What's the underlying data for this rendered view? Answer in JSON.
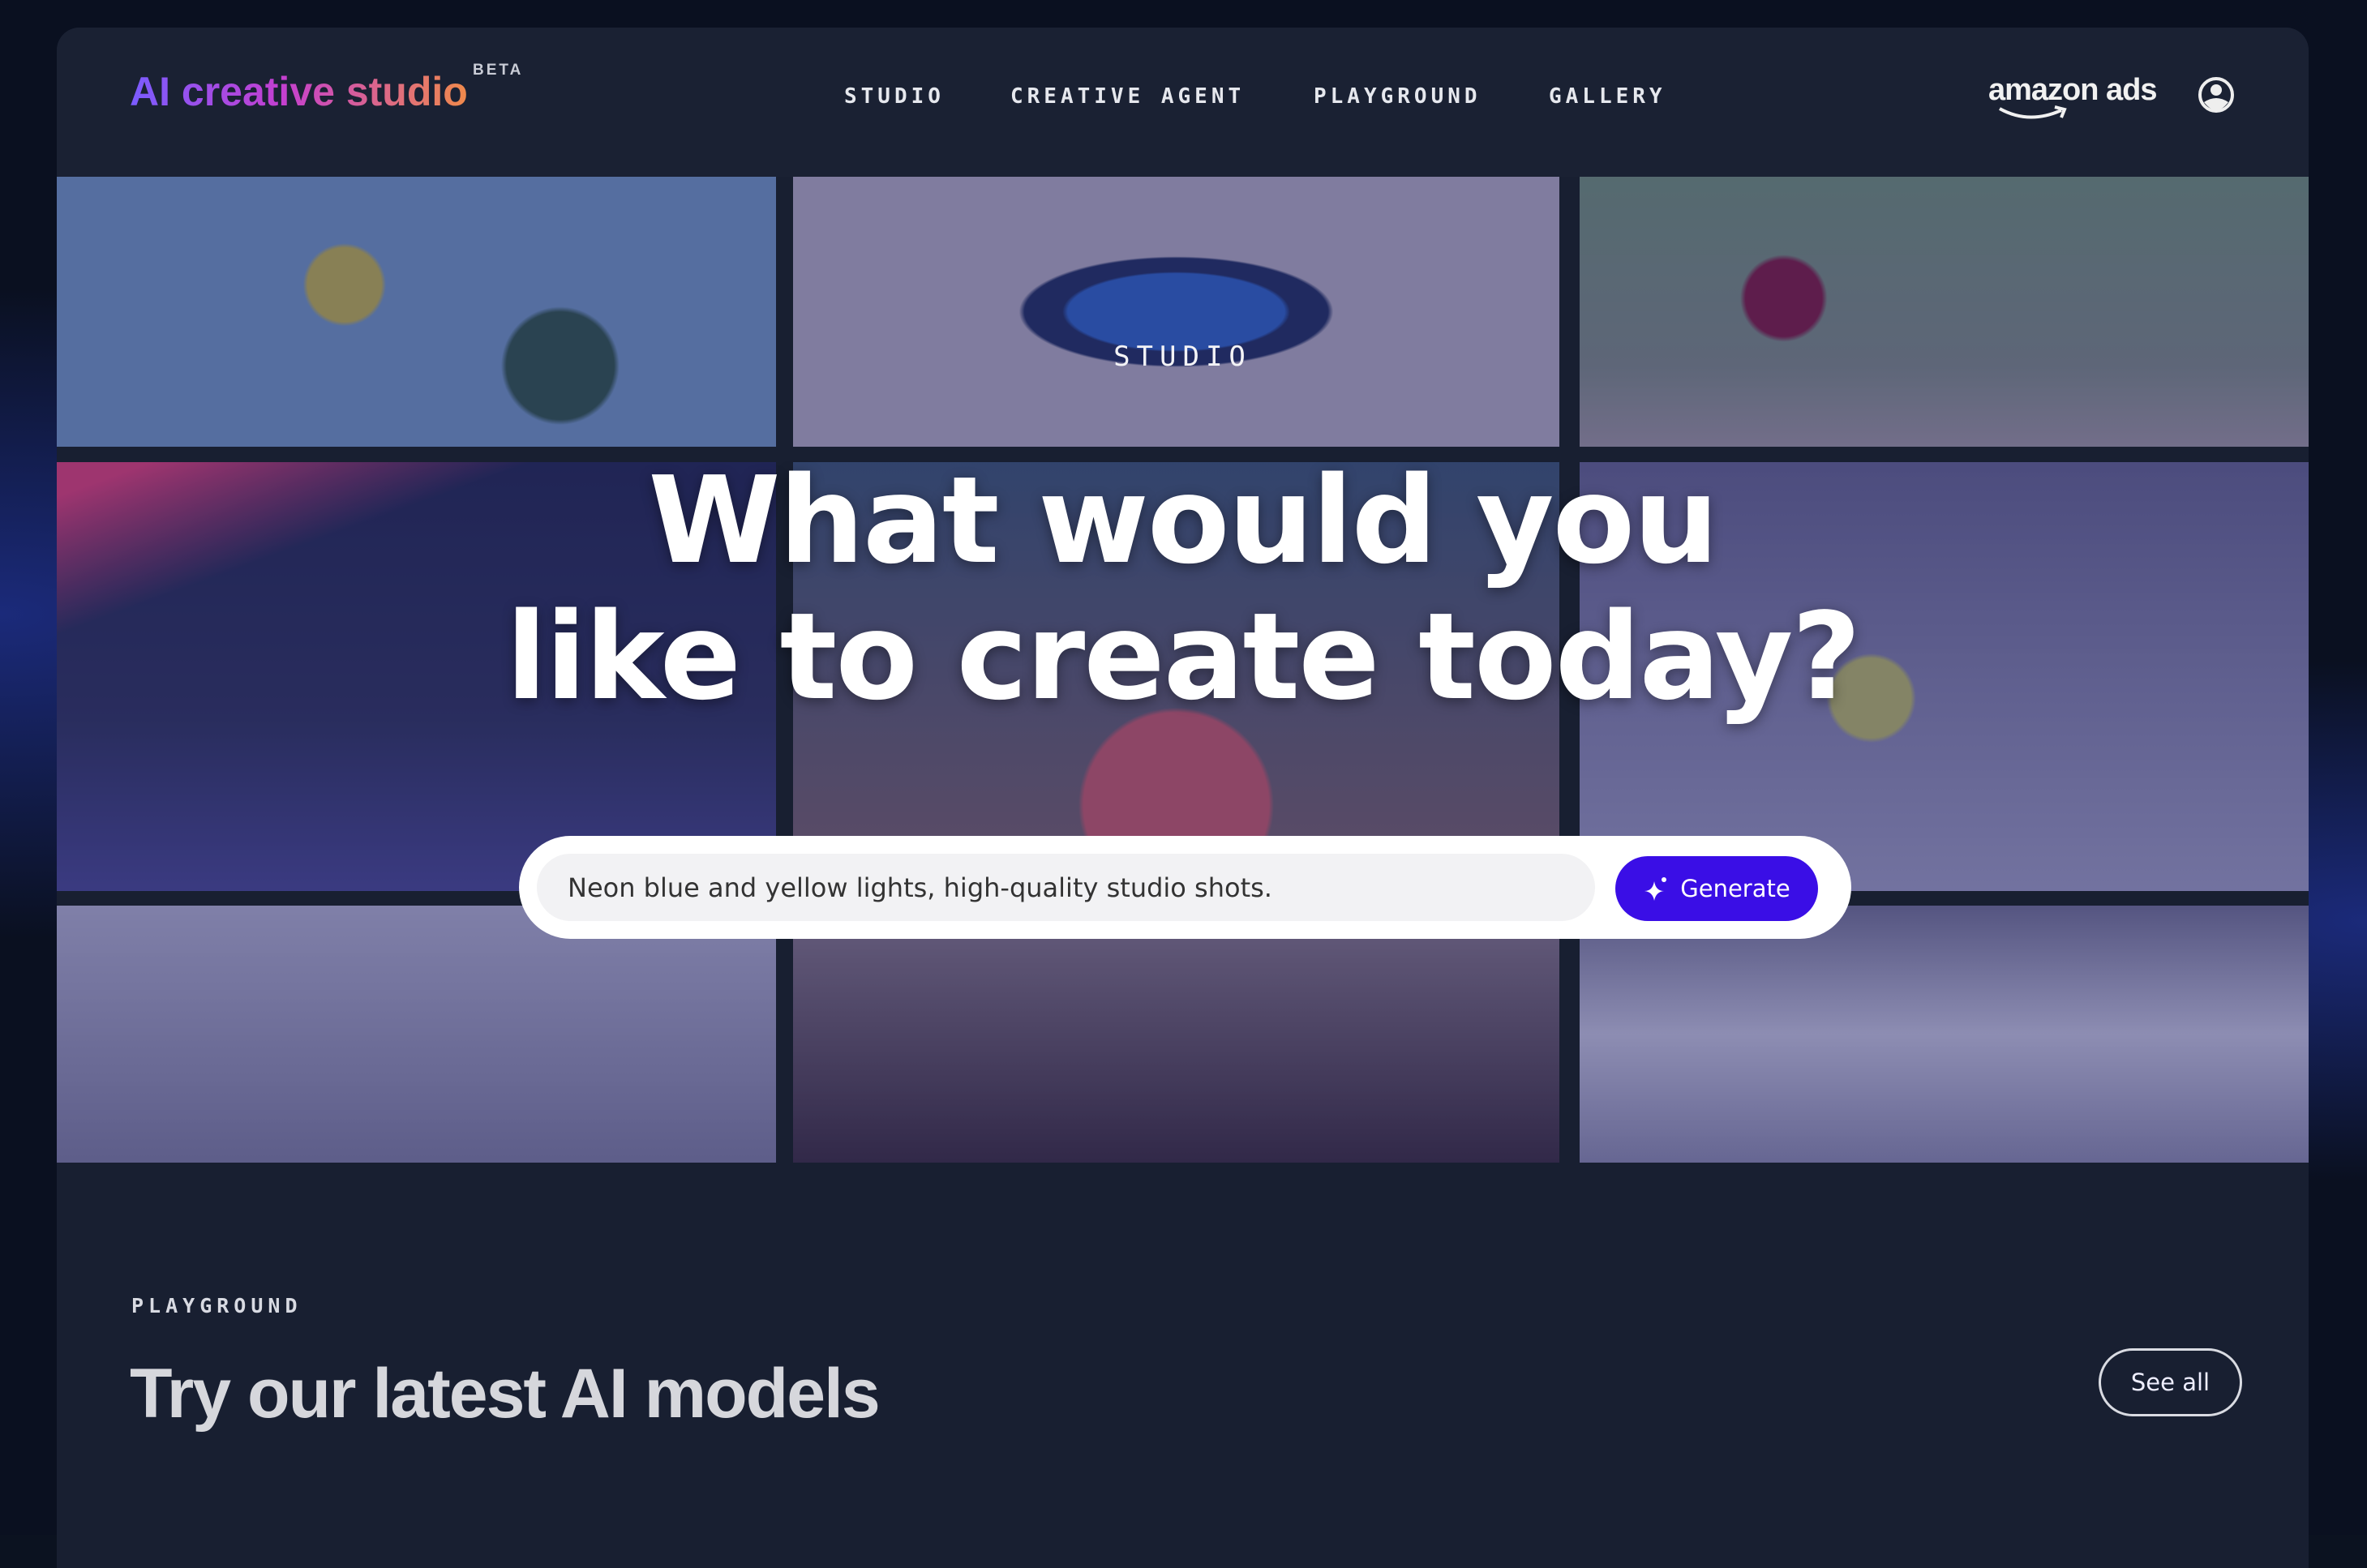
{
  "header": {
    "logo": "AI creative studio",
    "badge": "BETA",
    "nav": [
      {
        "label": "STUDIO"
      },
      {
        "label": "CREATIVE AGENT"
      },
      {
        "label": "PLAYGROUND"
      },
      {
        "label": "GALLERY"
      }
    ],
    "brand": "amazon ads",
    "account_icon": "user-circle-icon"
  },
  "hero": {
    "eyebrow": "STUDIO",
    "headline_line1": "What would you",
    "headline_line2": "like to create today?",
    "prompt_value": "Neon blue and yellow lights, high-quality studio shots.",
    "generate_label": "Generate",
    "generate_icon": "sparkle-icon",
    "accent": "#3a0ee6"
  },
  "playground": {
    "eyebrow": "PLAYGROUND",
    "title": "Try our latest AI models",
    "see_all": "See all"
  }
}
